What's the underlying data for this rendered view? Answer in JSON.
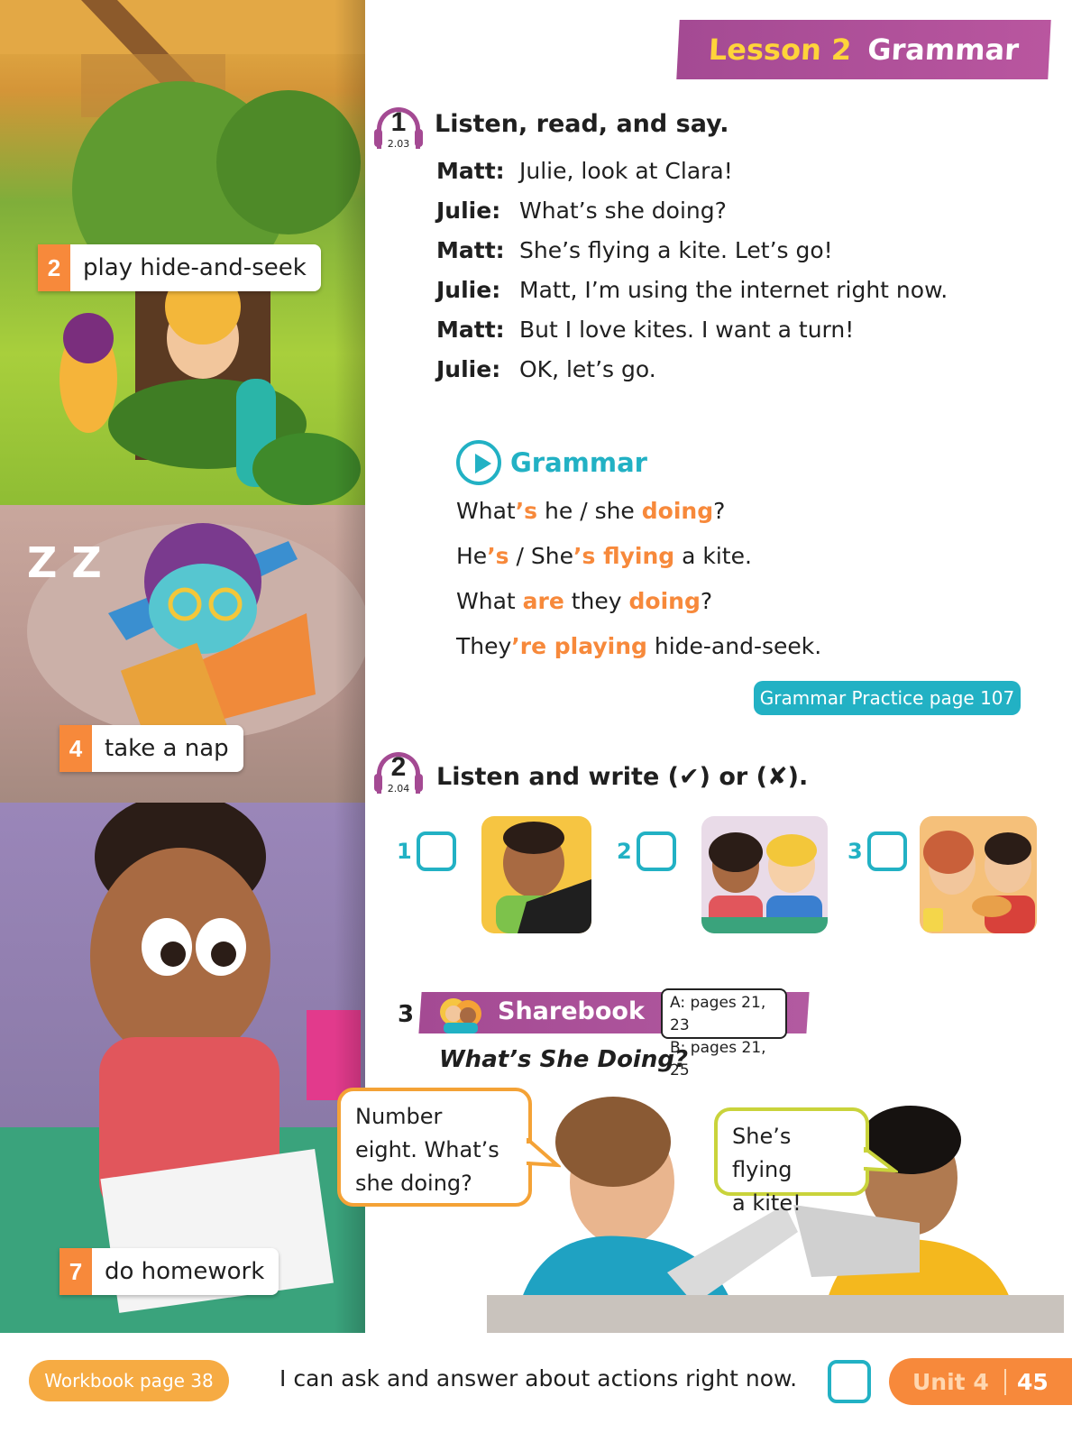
{
  "header": {
    "lesson_number": "Lesson 2",
    "lesson_title": "Grammar"
  },
  "scenes": [
    {
      "num": "2",
      "label": "play hide-and-seek"
    },
    {
      "num": "4",
      "label": "take a nap"
    },
    {
      "num": "7",
      "label": "do homework"
    }
  ],
  "activity1": {
    "num": "1",
    "track": "2.03",
    "title": "Listen, read, and say.",
    "dialogue": [
      {
        "speaker": "Matt:",
        "line": "Julie, look at Clara!"
      },
      {
        "speaker": "Julie:",
        "line": "What’s she doing?"
      },
      {
        "speaker": "Matt:",
        "line": "She’s flying a kite. Let’s go!"
      },
      {
        "speaker": "Julie:",
        "line": "Matt, I’m using the internet right now."
      },
      {
        "speaker": "Matt:",
        "line": "But I love kites. I want a turn!"
      },
      {
        "speaker": "Julie:",
        "line": "OK, let’s go."
      }
    ]
  },
  "grammar": {
    "heading": "Grammar",
    "lines": [
      [
        {
          "t": "What"
        },
        {
          "t": "’s",
          "h": true
        },
        {
          "t": " he / she "
        },
        {
          "t": "doing",
          "h": true
        },
        {
          "t": "?"
        }
      ],
      [
        {
          "t": "He"
        },
        {
          "t": "’s",
          "h": true
        },
        {
          "t": " / She"
        },
        {
          "t": "’s flying",
          "h": true
        },
        {
          "t": " a kite."
        }
      ],
      [
        {
          "t": "What "
        },
        {
          "t": "are",
          "h": true
        },
        {
          "t": " they "
        },
        {
          "t": "doing",
          "h": true
        },
        {
          "t": "?"
        }
      ],
      [
        {
          "t": "They"
        },
        {
          "t": "’re playing",
          "h": true
        },
        {
          "t": " hide-and-seek."
        }
      ]
    ],
    "practice_link": "Grammar Practice page 107"
  },
  "activity2": {
    "num": "2",
    "track": "2.04",
    "title": "Listen and write (✔) or (✘).",
    "items": [
      "1",
      "2",
      "3"
    ]
  },
  "sharebook": {
    "num": "3",
    "label": "Sharebook",
    "pages_a": "A: pages 21, 23",
    "pages_b": "B: pages 21, 25",
    "subtitle": "What’s She Doing?",
    "bubble_left": [
      "Number",
      "eight. What’s",
      "she doing?"
    ],
    "bubble_right": [
      "She’s flying",
      "a kite!"
    ]
  },
  "footer": {
    "workbook": "Workbook page 38",
    "can_do": "I can ask and answer about actions right now.",
    "unit": "Unit 4",
    "page": "45"
  },
  "colors": {
    "purple": "#a44a93",
    "teal": "#22b1c4",
    "orange": "#f7893b",
    "yellow": "#ffd43a"
  }
}
